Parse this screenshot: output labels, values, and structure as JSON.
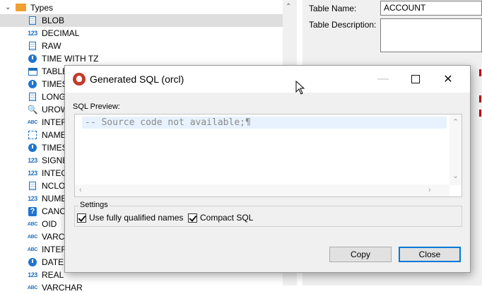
{
  "tree": {
    "root_label": "Types",
    "items": [
      {
        "icon": "document-icon",
        "label": "BLOB",
        "selected": true
      },
      {
        "icon": "number-icon",
        "label": "DECIMAL"
      },
      {
        "icon": "document-icon",
        "label": "RAW"
      },
      {
        "icon": "clock-icon",
        "label": "TIME WITH TZ"
      },
      {
        "icon": "table-icon",
        "label": "TABLE"
      },
      {
        "icon": "clock-icon",
        "label": "TIMES"
      },
      {
        "icon": "document-icon",
        "label": "LONG"
      },
      {
        "icon": "key-icon",
        "label": "UROW"
      },
      {
        "icon": "abc-icon",
        "label": "INTER"
      },
      {
        "icon": "grid-icon",
        "label": "NAME"
      },
      {
        "icon": "clock-icon",
        "label": "TIMES"
      },
      {
        "icon": "number-icon",
        "label": "SIGNE"
      },
      {
        "icon": "number-icon",
        "label": "INTEG"
      },
      {
        "icon": "document-icon",
        "label": "NCLO"
      },
      {
        "icon": "number-icon",
        "label": "NUME"
      },
      {
        "icon": "question-icon",
        "label": "CANO"
      },
      {
        "icon": "abc-icon",
        "label": "OID"
      },
      {
        "icon": "abc-icon",
        "label": "VARCH"
      },
      {
        "icon": "abc-icon",
        "label": "INTER"
      },
      {
        "icon": "clock-icon",
        "label": "DATE"
      },
      {
        "icon": "number-icon",
        "label": "REAL"
      },
      {
        "icon": "abc-icon",
        "label": "VARCHAR"
      }
    ],
    "number_glyph": "123",
    "abc_glyph": "ABC",
    "question_glyph": "?",
    "key_glyph": "🔍"
  },
  "properties": {
    "table_name_label": "Table Name:",
    "table_name_value": "ACCOUNT",
    "table_description_label": "Table Description:",
    "table_description_value": ""
  },
  "dialog": {
    "title": "Generated SQL (orcl)",
    "sql_preview_label": "SQL Preview:",
    "sql_code": "-- Source code not available;¶",
    "settings_label": "Settings",
    "use_fully_qualified_names_label": "Use fully qualified names",
    "use_fully_qualified_names_checked": true,
    "compact_sql_label": "Compact SQL",
    "compact_sql_checked": true,
    "copy_label": "Copy",
    "close_label": "Close",
    "minimize_glyph": "—",
    "close_glyph": "✕"
  }
}
